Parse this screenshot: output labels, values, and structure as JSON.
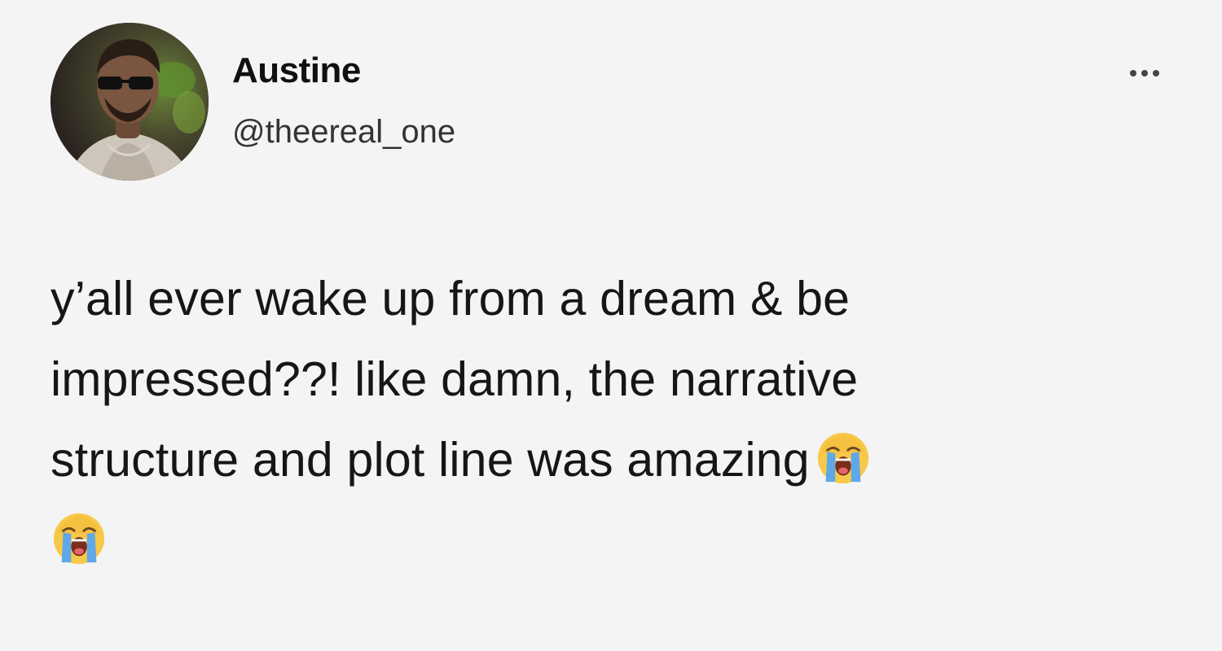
{
  "tweet": {
    "author": {
      "display_name": "Austine",
      "handle": "@theereal_one",
      "avatar_icon": "profile-photo"
    },
    "more_icon": "more-horizontal-icon",
    "text_lines": [
      "y’all ever wake up from a dream & be",
      "impressed??! like damn, the narrative",
      "structure and plot line was amazing"
    ],
    "emojis": [
      "loudly-crying-face",
      "loudly-crying-face"
    ],
    "colors": {
      "background": "#f4f4f4",
      "text": "#161616",
      "handle": "#333333"
    }
  }
}
